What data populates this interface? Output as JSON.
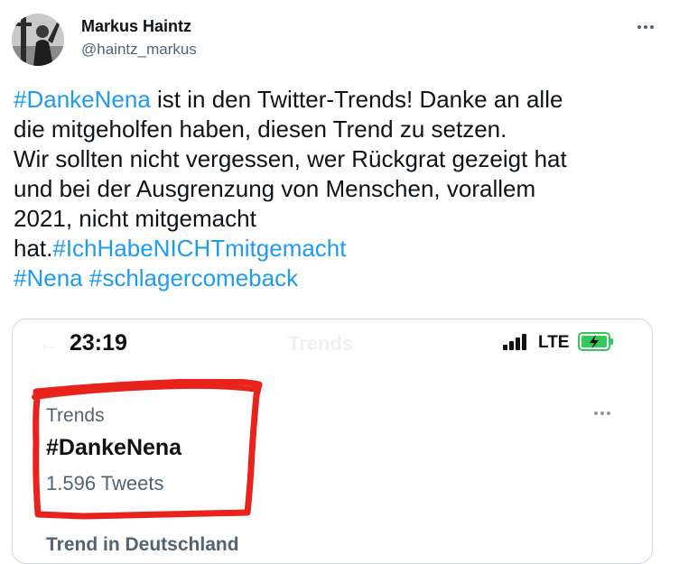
{
  "author": {
    "name": "Markus Haintz",
    "handle": "@haintz_markus"
  },
  "more_icon": "more-horizontal-icon",
  "tweet": {
    "line1": {
      "hashtag": "#DankeNena",
      "text": " ist in den Twitter-Trends! Danke an alle"
    },
    "line2": "die mitgeholfen haben, diesen Trend zu setzen.",
    "line3": "Wir sollten nicht vergessen, wer Rückgrat gezeigt hat",
    "line4": "und bei der Ausgrenzung von Menschen, vorallem",
    "line5": "2021, nicht mitgemacht",
    "line6": {
      "text": "hat.",
      "hashtag": "#IchHabeNICHTmitgemacht"
    },
    "line7": {
      "hashtag1": "#Nena",
      "hashtag2": "#schlagercomeback"
    }
  },
  "media": {
    "status_time": "23:19",
    "network": "LTE",
    "ghost_title": "Trends",
    "trend": {
      "context": "Trends",
      "name": "#DankeNena",
      "count": "1.596 Tweets"
    },
    "next_trend_partial": "Trend in Deutschland",
    "highlight_color": "#e8231b",
    "battery_color": "#34c759"
  },
  "colors": {
    "link": "#1d9bf0",
    "text": "#0f1419",
    "secondary": "#536471"
  }
}
